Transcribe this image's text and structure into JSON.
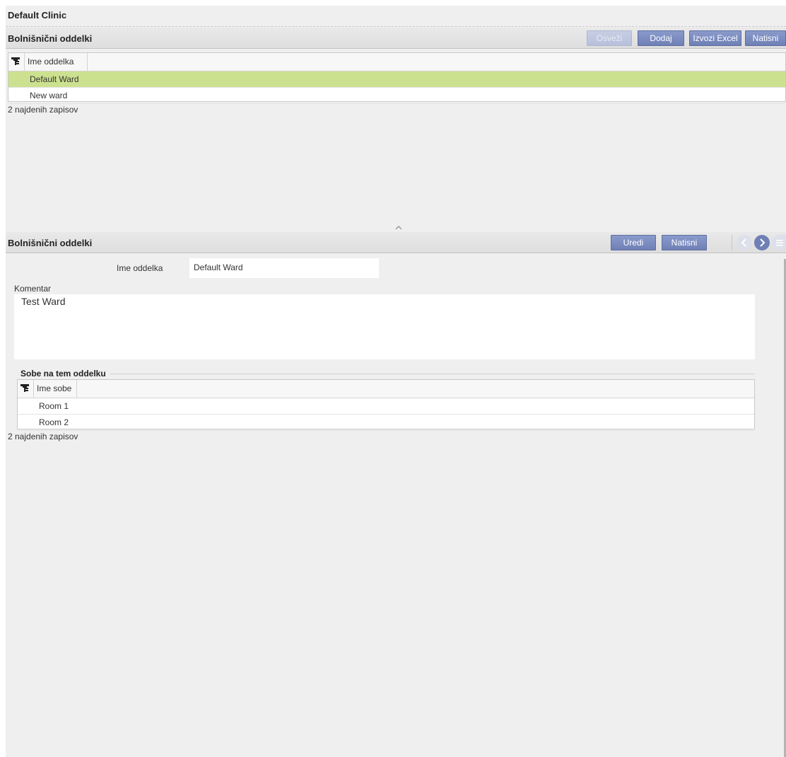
{
  "clinic": {
    "title": "Default Clinic"
  },
  "top_section": {
    "title": "Bolnišnični oddelki",
    "buttons": {
      "refresh": "Osveži",
      "add": "Dodaj",
      "export": "Izvozi Excel",
      "print": "Natisni"
    },
    "grid": {
      "column": "Ime oddelka",
      "rows": [
        "Default Ward",
        "New ward"
      ],
      "selected_index": 0
    },
    "count": "2 najdenih zapisov"
  },
  "detail_section": {
    "title": "Bolnišnični oddelki",
    "buttons": {
      "edit": "Uredi",
      "print": "Natisni"
    },
    "name_label": "Ime oddelka",
    "name_value": "Default Ward",
    "comment_label": "Komentar",
    "comment_value": "Test Ward",
    "rooms": {
      "legend": "Sobe na tem oddelku",
      "column": "Ime sobe",
      "rows": [
        "Room 1",
        "Room 2"
      ],
      "count": "2 najdenih zapisov"
    }
  },
  "colors": {
    "selected_row": "#cce18f",
    "button": "#6f80b6",
    "background": "#efefef"
  }
}
